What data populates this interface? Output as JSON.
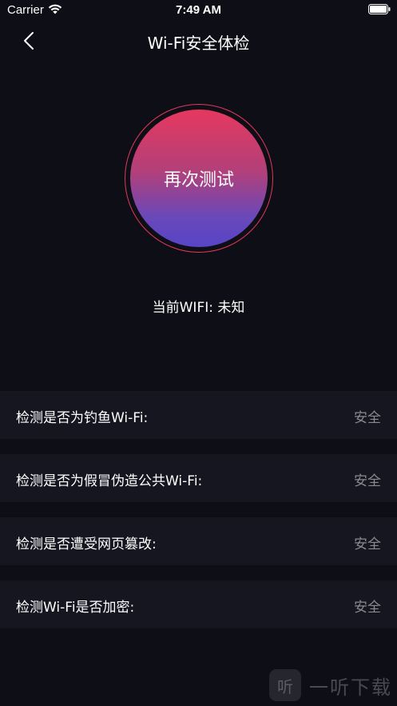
{
  "status_bar": {
    "carrier": "Carrier",
    "time": "7:49 AM"
  },
  "nav": {
    "title": "Wi-Fi安全体检",
    "back_icon": "chevron-left-icon"
  },
  "test": {
    "button_label": "再次测试",
    "current_wifi": "当前WIFI: 未知",
    "ring_color": "#e6365b",
    "gradient_top": "#e6385e",
    "gradient_bottom": "#5745c8"
  },
  "checks": [
    {
      "label": "检测是否为钓鱼Wi-Fi:",
      "status": "安全"
    },
    {
      "label": "检测是否为假冒伪造公共Wi-Fi:",
      "status": "安全"
    },
    {
      "label": "检测是否遭受网页篡改:",
      "status": "安全"
    },
    {
      "label": "检测Wi-Fi是否加密:",
      "status": "安全"
    }
  ],
  "watermark": {
    "logo": "听",
    "text": "一听下载"
  }
}
